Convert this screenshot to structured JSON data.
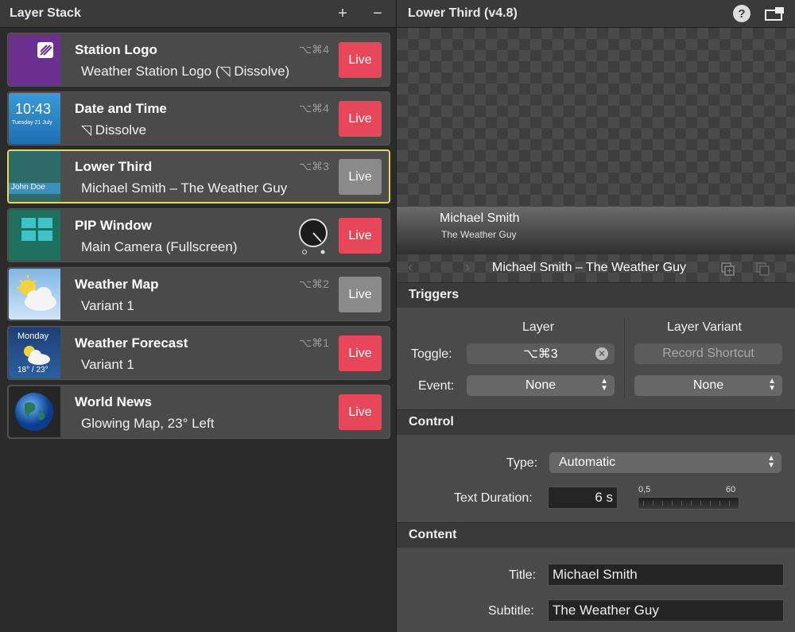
{
  "left": {
    "title": "Layer Stack",
    "add_label": "+",
    "remove_label": "−",
    "layers": [
      {
        "name": "Station Logo",
        "detail": "Weather Station Logo (◹ Dissolve)",
        "shortcut": "⌥⌘4",
        "live": "Live",
        "active": true
      },
      {
        "name": "Date and Time",
        "detail": "◹ Dissolve",
        "shortcut": "⌥⌘4",
        "live": "Live",
        "active": true,
        "thumb_time": "10:43",
        "thumb_date": "Tuesday 21 July"
      },
      {
        "name": "Lower Third",
        "detail": "Michael Smith – The Weather Guy",
        "shortcut": "⌥⌘3",
        "live": "Live",
        "active": false,
        "thumb_text": "John Doe"
      },
      {
        "name": "PIP Window",
        "detail": "Main Camera (Fullscreen)",
        "shortcut": "",
        "live": "Live",
        "active": true
      },
      {
        "name": "Weather Map",
        "detail": "Variant 1",
        "shortcut": "⌥⌘2",
        "live": "Live",
        "active": false
      },
      {
        "name": "Weather Forecast",
        "detail": "Variant 1",
        "shortcut": "⌥⌘1",
        "live": "Live",
        "active": true,
        "thumb_day": "Monday",
        "thumb_temp": "18° / 23°"
      },
      {
        "name": "World News",
        "detail": "Glowing Map, 23° Left",
        "shortcut": "",
        "live": "Live",
        "active": true
      }
    ]
  },
  "right": {
    "title": "Lower Third (v4.8)",
    "help_label": "?",
    "preview": {
      "name": "Michael Smith",
      "subtitle": "The Weather Guy"
    },
    "variant_name": "Michael Smith – The Weather Guy",
    "triggers": {
      "heading": "Triggers",
      "col_layer": "Layer",
      "col_variant": "Layer Variant",
      "toggle_label": "Toggle:",
      "toggle_value": "⌥⌘3",
      "record_label": "Record Shortcut",
      "event_label": "Event:",
      "event_layer": "None",
      "event_variant": "None"
    },
    "control": {
      "heading": "Control",
      "type_label": "Type:",
      "type_value": "Automatic",
      "duration_label": "Text Duration:",
      "duration_value": "6 s",
      "slider_min": "0,5",
      "slider_max": "60"
    },
    "content": {
      "heading": "Content",
      "title_label": "Title:",
      "title_value": "Michael Smith",
      "subtitle_label": "Subtitle:",
      "subtitle_value": "The Weather Guy"
    }
  },
  "colors": {
    "live": "#e8475a",
    "live_off": "#8a8a8a",
    "selected_border": "#e8d84a"
  }
}
